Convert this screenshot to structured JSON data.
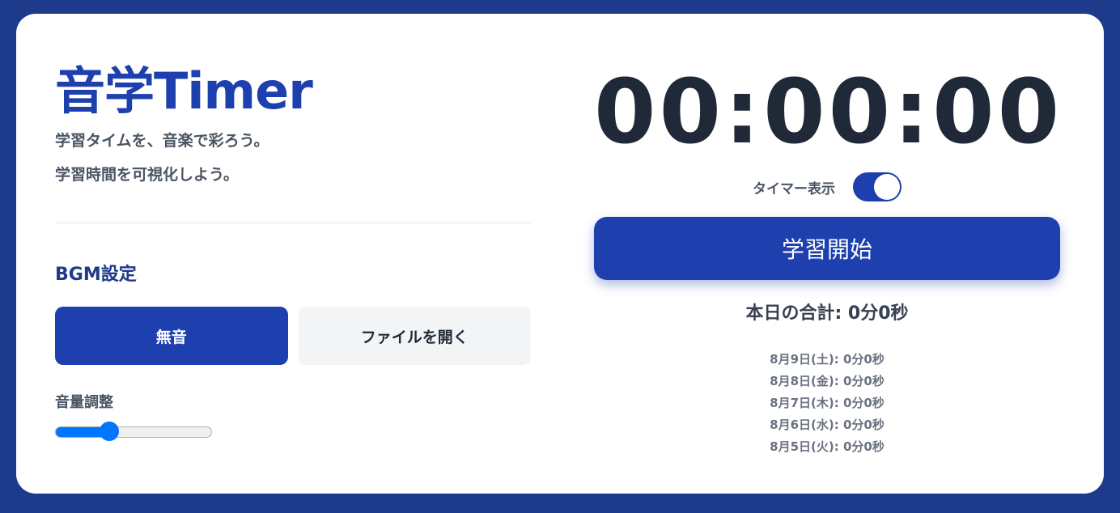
{
  "app": {
    "title": "音学Timer",
    "tagline1": "学習タイムを、音楽で彩ろう。",
    "tagline2": "学習時間を可視化しよう。"
  },
  "bgm": {
    "heading": "BGM設定",
    "mute_label": "無音",
    "open_file_label": "ファイルを開く",
    "volume_label": "音量調整",
    "volume_value": 0.32
  },
  "timer": {
    "display": "00:00:00",
    "toggle_label": "タイマー表示",
    "toggle_on": true,
    "start_label": "学習開始"
  },
  "stats": {
    "today_total": "本日の合計: 0分0秒",
    "history": [
      "8月9日(土): 0分0秒",
      "8月8日(金): 0分0秒",
      "8月7日(木): 0分0秒",
      "8月6日(水): 0分0秒",
      "8月5日(火): 0分0秒"
    ]
  },
  "colors": {
    "background": "#1e3a8a",
    "accent": "#1e40af",
    "slider": "#0075ff"
  }
}
